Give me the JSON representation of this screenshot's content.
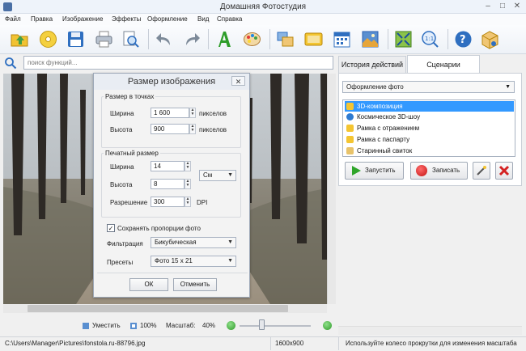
{
  "window": {
    "title": "Домашняя Фотостудия",
    "min": "–",
    "max": "□",
    "close": "✕"
  },
  "menu": [
    "Файл",
    "Правка",
    "Изображение",
    "Эффекты",
    "Оформление",
    "Вид",
    "Справка"
  ],
  "toolbar": {
    "icons": [
      "open-folder-icon",
      "disc-icon",
      "save-icon",
      "print-icon",
      "print-preview-icon",
      "undo-icon",
      "redo-icon",
      "text-icon",
      "palette-icon",
      "frame-icon",
      "card-icon",
      "calendar-icon",
      "collage-icon",
      "fit-icon",
      "actual-size-icon",
      "help-icon",
      "box-icon"
    ]
  },
  "search": {
    "placeholder": "поиск функций..."
  },
  "dialog": {
    "title": "Размер изображения",
    "close": "✕",
    "pixels_group": "Размер в точках",
    "width_label": "Ширина",
    "width_value": "1 600",
    "width_unit": "пикселов",
    "height_label": "Высота",
    "height_value": "900",
    "height_unit": "пикселов",
    "print_group": "Печатный размер",
    "print_width_label": "Ширина",
    "print_width_value": "14",
    "print_height_label": "Высота",
    "print_height_value": "8",
    "unit_value": "См",
    "resolution_label": "Разрешение",
    "resolution_value": "300",
    "resolution_unit": "DPI",
    "keep_proportions": "Сохранять пропорции фото",
    "keep_proportions_checked": "✓",
    "filter_label": "Фильтрация",
    "filter_value": "Бикубическая",
    "preset_label": "Пресеты",
    "preset_value": "Фото 15 x 21",
    "ok": "ОК",
    "cancel": "Отменить"
  },
  "panel": {
    "tab_history": "История действий",
    "tab_scenarios": "Сценарии",
    "combo_value": "Оформление фото",
    "items": [
      {
        "label": "3D-композиция",
        "selected": true
      },
      {
        "label": "Космическое 3D-шоу",
        "selected": false
      },
      {
        "label": "Рамка с отражением",
        "selected": false
      },
      {
        "label": "Рамка с паспарту",
        "selected": false
      },
      {
        "label": "Старинный свиток",
        "selected": false
      }
    ],
    "run": "Запустить",
    "record": "Записать"
  },
  "bottom": {
    "fit": "Уместить",
    "full": "100%",
    "zoom_label": "Масштаб:",
    "zoom_value": "40%"
  },
  "status": {
    "path": "C:\\Users\\Manager\\Pictures\\fonstola.ru-88796.jpg",
    "resolution": "1600x900",
    "hint": "Используйте колесо прокрутки для изменения масштаба"
  },
  "colors": {
    "selection": "#3399ff",
    "run": "#2fa52a",
    "record": "#d42222",
    "accent": "#2a5fb0"
  }
}
